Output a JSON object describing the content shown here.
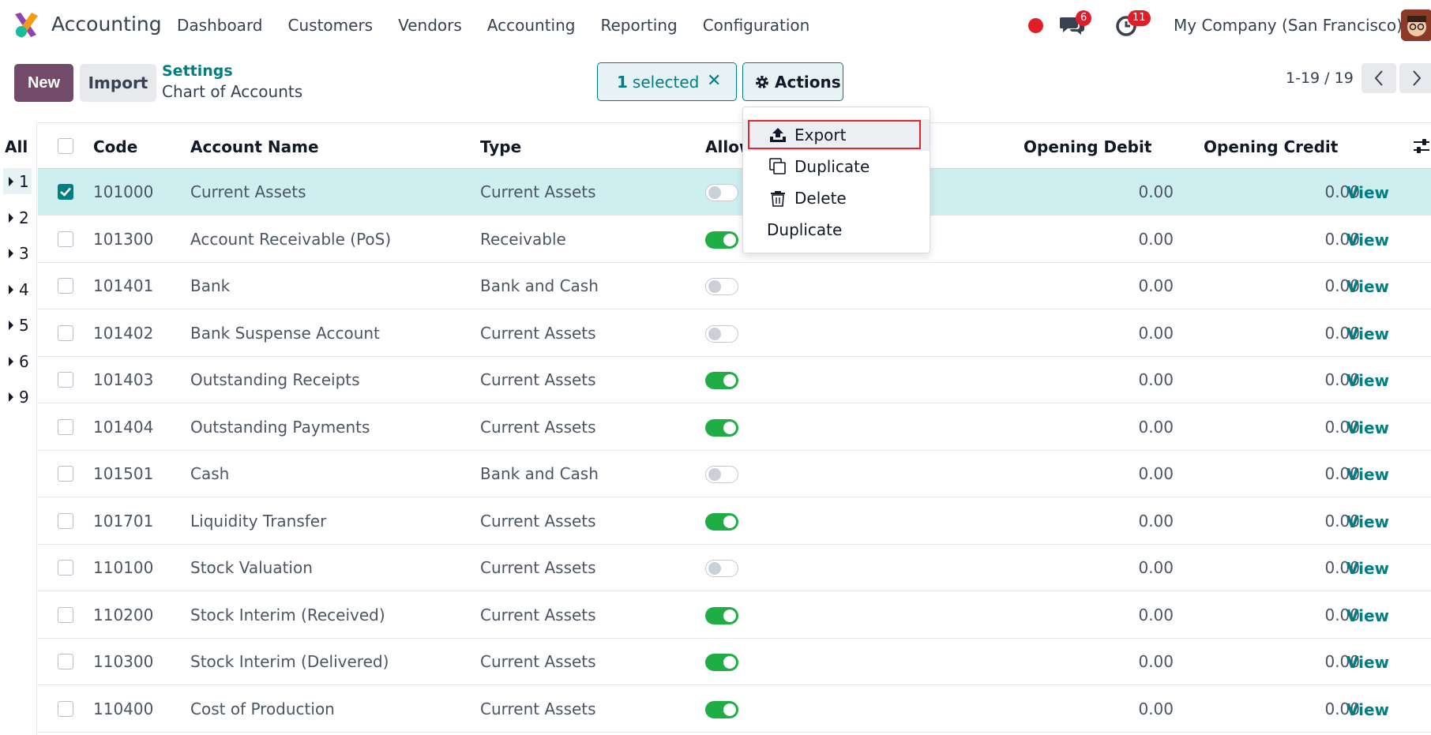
{
  "navbar": {
    "app_name": "Accounting",
    "menu": [
      "Dashboard",
      "Customers",
      "Vendors",
      "Accounting",
      "Reporting",
      "Configuration"
    ],
    "messages_badge": "6",
    "activities_badge": "11",
    "company": "My Company (San Francisco)"
  },
  "control_panel": {
    "new_label": "New",
    "import_label": "Import",
    "breadcrumb_parent": "Settings",
    "breadcrumb_current": "Chart of Accounts",
    "selected_count": "1",
    "selected_text": "selected",
    "actions_label": "Actions",
    "pager": "1-19 / 19"
  },
  "actions_menu": {
    "items": [
      "Export",
      "Duplicate",
      "Delete",
      "Duplicate"
    ],
    "highlighted": "Export"
  },
  "sidebar": {
    "all_label": "All",
    "groups": [
      "1",
      "2",
      "3",
      "4",
      "5",
      "6",
      "9"
    ]
  },
  "table": {
    "columns": {
      "code": "Code",
      "account_name": "Account Name",
      "type": "Type",
      "allow": "Allow",
      "opening_debit": "Opening Debit",
      "opening_credit": "Opening Credit"
    },
    "view_label": "View",
    "rows": [
      {
        "code": "101000",
        "name": "Current Assets",
        "type": "Current Assets",
        "allow": false,
        "debit": "0.00",
        "credit": "0.00",
        "selected": true
      },
      {
        "code": "101300",
        "name": "Account Receivable (PoS)",
        "type": "Receivable",
        "allow": true,
        "debit": "0.00",
        "credit": "0.00",
        "selected": false
      },
      {
        "code": "101401",
        "name": "Bank",
        "type": "Bank and Cash",
        "allow": false,
        "debit": "0.00",
        "credit": "0.00",
        "selected": false
      },
      {
        "code": "101402",
        "name": "Bank Suspense Account",
        "type": "Current Assets",
        "allow": false,
        "debit": "0.00",
        "credit": "0.00",
        "selected": false
      },
      {
        "code": "101403",
        "name": "Outstanding Receipts",
        "type": "Current Assets",
        "allow": true,
        "debit": "0.00",
        "credit": "0.00",
        "selected": false
      },
      {
        "code": "101404",
        "name": "Outstanding Payments",
        "type": "Current Assets",
        "allow": true,
        "debit": "0.00",
        "credit": "0.00",
        "selected": false
      },
      {
        "code": "101501",
        "name": "Cash",
        "type": "Bank and Cash",
        "allow": false,
        "debit": "0.00",
        "credit": "0.00",
        "selected": false
      },
      {
        "code": "101701",
        "name": "Liquidity Transfer",
        "type": "Current Assets",
        "allow": true,
        "debit": "0.00",
        "credit": "0.00",
        "selected": false
      },
      {
        "code": "110100",
        "name": "Stock Valuation",
        "type": "Current Assets",
        "allow": false,
        "debit": "0.00",
        "credit": "0.00",
        "selected": false
      },
      {
        "code": "110200",
        "name": "Stock Interim (Received)",
        "type": "Current Assets",
        "allow": true,
        "debit": "0.00",
        "credit": "0.00",
        "selected": false
      },
      {
        "code": "110300",
        "name": "Stock Interim (Delivered)",
        "type": "Current Assets",
        "allow": true,
        "debit": "0.00",
        "credit": "0.00",
        "selected": false
      },
      {
        "code": "110400",
        "name": "Cost of Production",
        "type": "Current Assets",
        "allow": true,
        "debit": "0.00",
        "credit": "0.00",
        "selected": false
      }
    ]
  },
  "colors": {
    "brand": "#714B67",
    "accent": "#017e84",
    "toggle_on": "#1fae45",
    "badge": "#e01e2a",
    "selected_row": "#cfeef0"
  },
  "icons": {
    "logo": "odoo-accounting-logo",
    "messages": "chat-bubbles-icon",
    "activities": "clock-icon",
    "actions": "gear-icon",
    "export": "upload-icon",
    "duplicate": "copy-icon",
    "delete": "trash-icon",
    "settings": "sliders-icon"
  }
}
